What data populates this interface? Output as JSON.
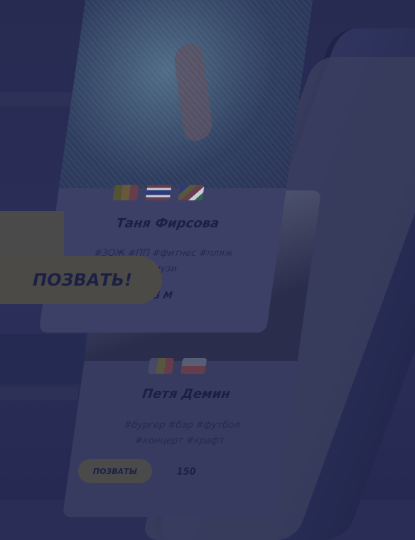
{
  "cards": [
    {
      "name": "Таня Фирсова",
      "tags_line1": "#ЗОЖ #ПП #фитнес #пляж",
      "tags_line2": "#музи",
      "likes": "1,5 М"
    },
    {
      "name": "Петя Демин",
      "tags_line1": "#бургер #бар #футбол",
      "tags_line2": "#концерт #крафт",
      "likes": "150"
    }
  ],
  "cta": {
    "big_label": "ПОЗВАТЬ!",
    "small_label": "ПОЗВАТЫ"
  },
  "colors": {
    "background": "#2a2d55",
    "card": "#3d4066",
    "cta": "#4b4a47"
  },
  "icons": {
    "like": "heart-icon"
  }
}
